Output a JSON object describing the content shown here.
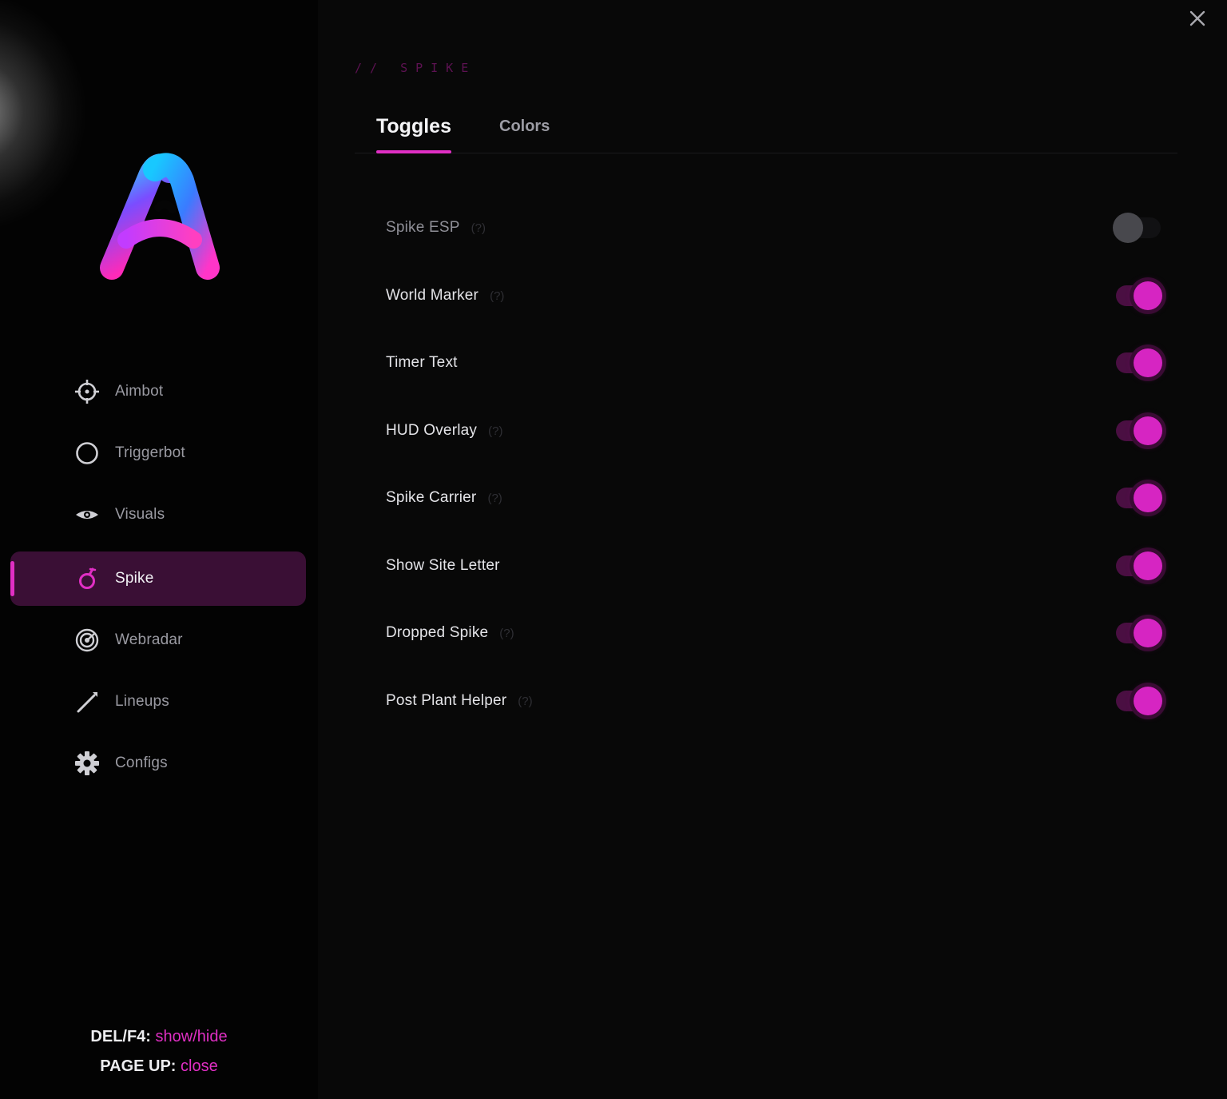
{
  "sidebar": {
    "logo_name": "app-logo-letter-a",
    "items": [
      {
        "label": "Aimbot",
        "icon": "crosshair-icon",
        "active": false
      },
      {
        "label": "Triggerbot",
        "icon": "circle-icon",
        "active": false
      },
      {
        "label": "Visuals",
        "icon": "eye-icon",
        "active": false
      },
      {
        "label": "Spike",
        "icon": "spike-bomb-icon",
        "active": true
      },
      {
        "label": "Webradar",
        "icon": "radar-icon",
        "active": false
      },
      {
        "label": "Lineups",
        "icon": "pencil-line-icon",
        "active": false
      },
      {
        "label": "Configs",
        "icon": "gear-icon",
        "active": false
      }
    ],
    "hotkeys": [
      {
        "key": "DEL/F4:",
        "action": "show/hide"
      },
      {
        "key": "PAGE UP:",
        "action": "close"
      }
    ]
  },
  "main": {
    "crumb": "// SPIKE",
    "tabs": [
      {
        "label": "Toggles",
        "active": true
      },
      {
        "label": "Colors",
        "active": false
      }
    ],
    "options": [
      {
        "label": "Spike ESP",
        "help": "(?)",
        "enabled": false
      },
      {
        "label": "World Marker",
        "help": "(?)",
        "enabled": true
      },
      {
        "label": "Timer Text",
        "help": "",
        "enabled": true
      },
      {
        "label": "HUD Overlay",
        "help": "(?)",
        "enabled": true
      },
      {
        "label": "Spike Carrier",
        "help": "(?)",
        "enabled": true
      },
      {
        "label": "Show Site Letter",
        "help": "",
        "enabled": true
      },
      {
        "label": "Dropped Spike",
        "help": "(?)",
        "enabled": true
      },
      {
        "label": "Post Plant Helper",
        "help": "(?)",
        "enabled": true
      }
    ]
  },
  "colors": {
    "accent": "#e02fc4",
    "active_nav_bg": "#3a0f35",
    "toggle_on_knob": "#d625c2",
    "toggle_off_knob": "#48484d"
  }
}
